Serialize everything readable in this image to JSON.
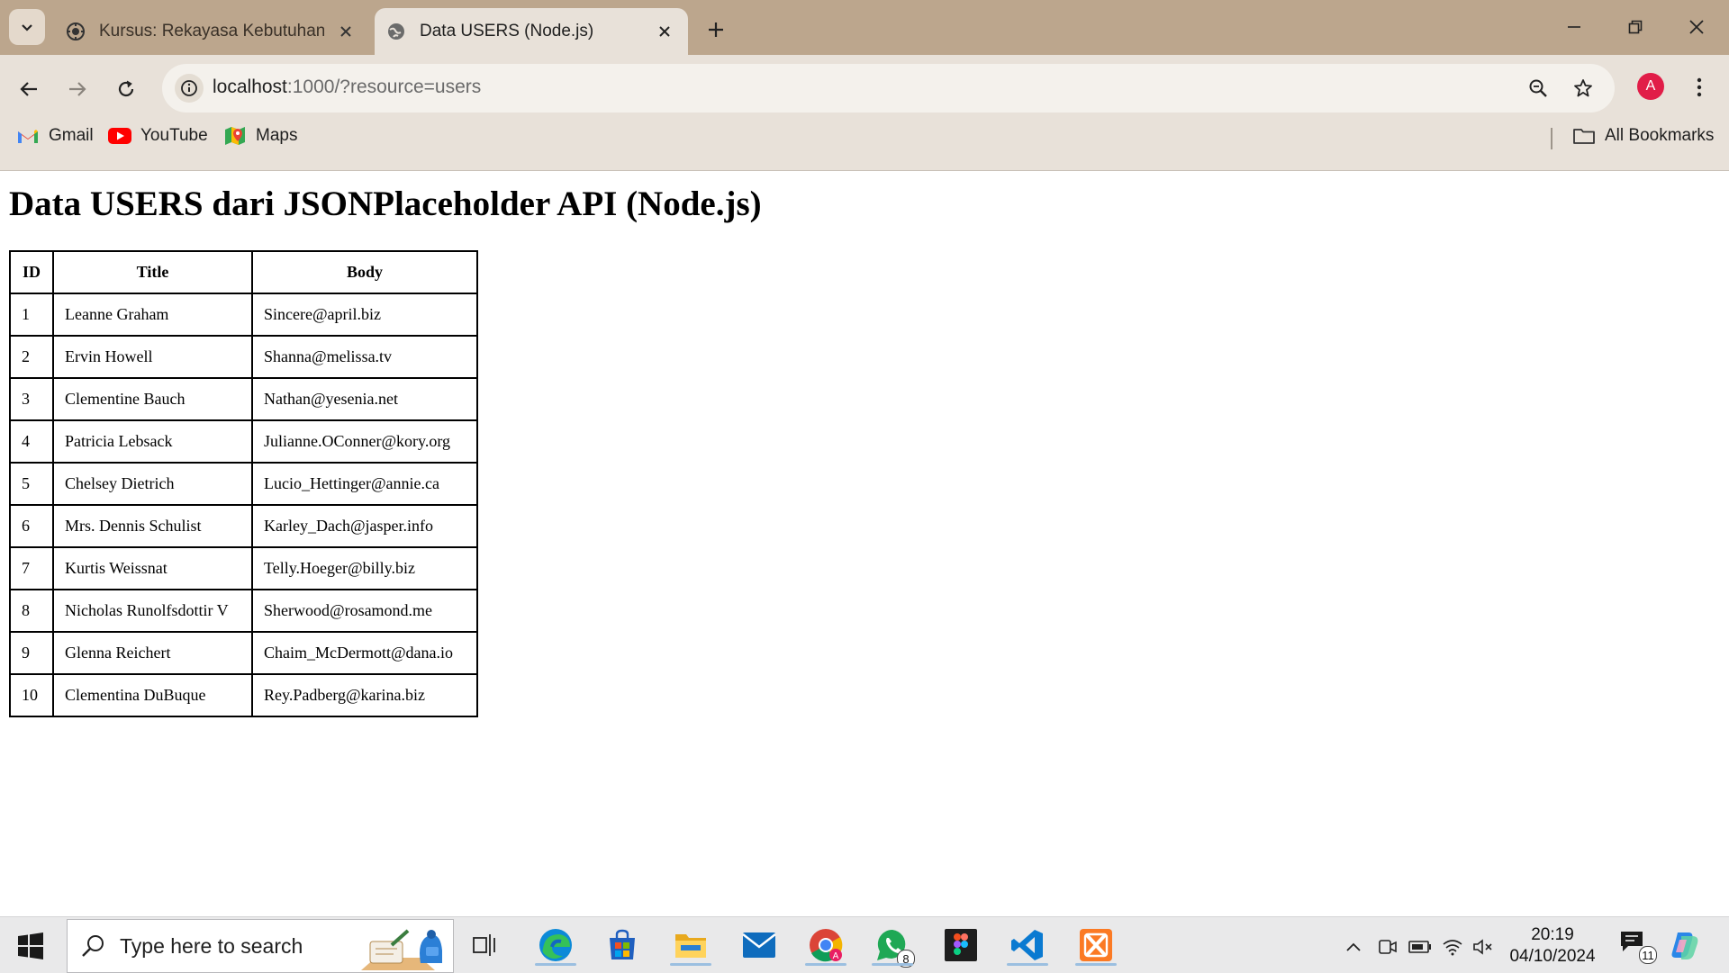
{
  "browser": {
    "tabs": [
      {
        "title": "Kursus: Rekayasa Kebutuhan Pe",
        "active": false
      },
      {
        "title": "Data USERS (Node.js)",
        "active": true
      }
    ],
    "address": {
      "host": "localhost",
      "rest": ":1000/?resource=users"
    },
    "profile_initial": "A",
    "bookmarks": [
      {
        "label": "Gmail",
        "icon": "gmail-icon"
      },
      {
        "label": "YouTube",
        "icon": "youtube-icon"
      },
      {
        "label": "Maps",
        "icon": "maps-icon"
      }
    ],
    "all_bookmarks": "All Bookmarks"
  },
  "page": {
    "heading": "Data USERS dari JSONPlaceholder API (Node.js)",
    "table": {
      "headers": [
        "ID",
        "Title",
        "Body"
      ],
      "rows": [
        [
          "1",
          "Leanne Graham",
          "Sincere@april.biz"
        ],
        [
          "2",
          "Ervin Howell",
          "Shanna@melissa.tv"
        ],
        [
          "3",
          "Clementine Bauch",
          "Nathan@yesenia.net"
        ],
        [
          "4",
          "Patricia Lebsack",
          "Julianne.OConner@kory.org"
        ],
        [
          "5",
          "Chelsey Dietrich",
          "Lucio_Hettinger@annie.ca"
        ],
        [
          "6",
          "Mrs. Dennis Schulist",
          "Karley_Dach@jasper.info"
        ],
        [
          "7",
          "Kurtis Weissnat",
          "Telly.Hoeger@billy.biz"
        ],
        [
          "8",
          "Nicholas Runolfsdottir V",
          "Sherwood@rosamond.me"
        ],
        [
          "9",
          "Glenna Reichert",
          "Chaim_McDermott@dana.io"
        ],
        [
          "10",
          "Clementina DuBuque",
          "Rey.Padberg@karina.biz"
        ]
      ]
    }
  },
  "taskbar": {
    "search_placeholder": "Type here to search",
    "whatsapp_badge": "8",
    "time": "20:19",
    "date": "04/10/2024",
    "notification_count": "11"
  },
  "colors": {
    "tab_bar": "#bca68d",
    "toolbar": "#e8e1d9",
    "avatar": "#e11d48"
  }
}
